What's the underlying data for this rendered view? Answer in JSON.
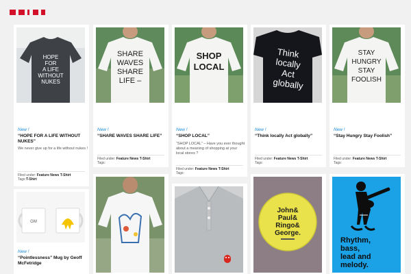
{
  "colors": {
    "accent": "#d4112a",
    "new_badge": "#1a8ad8",
    "page_bg": "#f1f1f1",
    "card_bg": "#ffffff"
  },
  "row1": [
    {
      "new": "New !",
      "title": "“HOPE FOR A LIFE WITHOUT NUKES”",
      "desc": "We never give up for a life without nukes !",
      "filed_label": "Filed under:",
      "filed_links": "Feature News T-Shirt",
      "tags_label": "Tags:",
      "tags_links": "T-Shirt",
      "shirt_text": [
        "HOPE",
        "FOR",
        "A LIFE",
        "WITHOUT",
        "NUKES"
      ]
    },
    {
      "new": "New !",
      "title": "“SHARE WAVES SHARE LIFE”",
      "filed_label": "Filed under:",
      "filed_links": "Feature News T-Shirt",
      "tags_label": "Tags:",
      "shirt_text": [
        "SHARE",
        "WAVES",
        "SHARE",
        "LIFE –"
      ]
    },
    {
      "new": "New !",
      "title": "“SHOP LOCAL”",
      "desc": "“SHOP LOCAL” – Have you ever thought about a meaning of shopping at your local stores ?",
      "filed_label": "Filed under:",
      "filed_links": "Feature News T-Shirt",
      "tags_label": "Tags:",
      "shirt_text": [
        "SHOP",
        "LOCAL"
      ]
    },
    {
      "new": "New !",
      "title": "“Think locally Act globally”",
      "filed_label": "Filed under:",
      "filed_links": "Feature News T-Shirt",
      "tags_label": "Tags:",
      "shirt_text": [
        "Think",
        "locally",
        "Act",
        "globally"
      ]
    },
    {
      "new": "New !",
      "title": "“Stay Hungry Stay Foolish”",
      "filed_label": "Filed under:",
      "filed_links": "Feature News T-Shirt",
      "tags_label": "Tags:",
      "shirt_text": [
        "STAY",
        "HUNGRY",
        "STAY",
        "FOOLISH"
      ]
    }
  ],
  "row2": [
    {
      "new": "New !",
      "title": "“Pointlessness” Mug by Geoff McFetridge",
      "mug_text": "GM"
    },
    {
      "image": "illustrated-tshirt"
    },
    {
      "image": "grey-polo"
    },
    {
      "image": "button-badge",
      "badge_text": [
        "John&",
        "Paul&",
        "Ringo&",
        "George."
      ]
    },
    {
      "image": "music-poster",
      "poster_text": [
        "Rhythm,",
        "bass,",
        "lead and",
        "melody."
      ]
    }
  ]
}
